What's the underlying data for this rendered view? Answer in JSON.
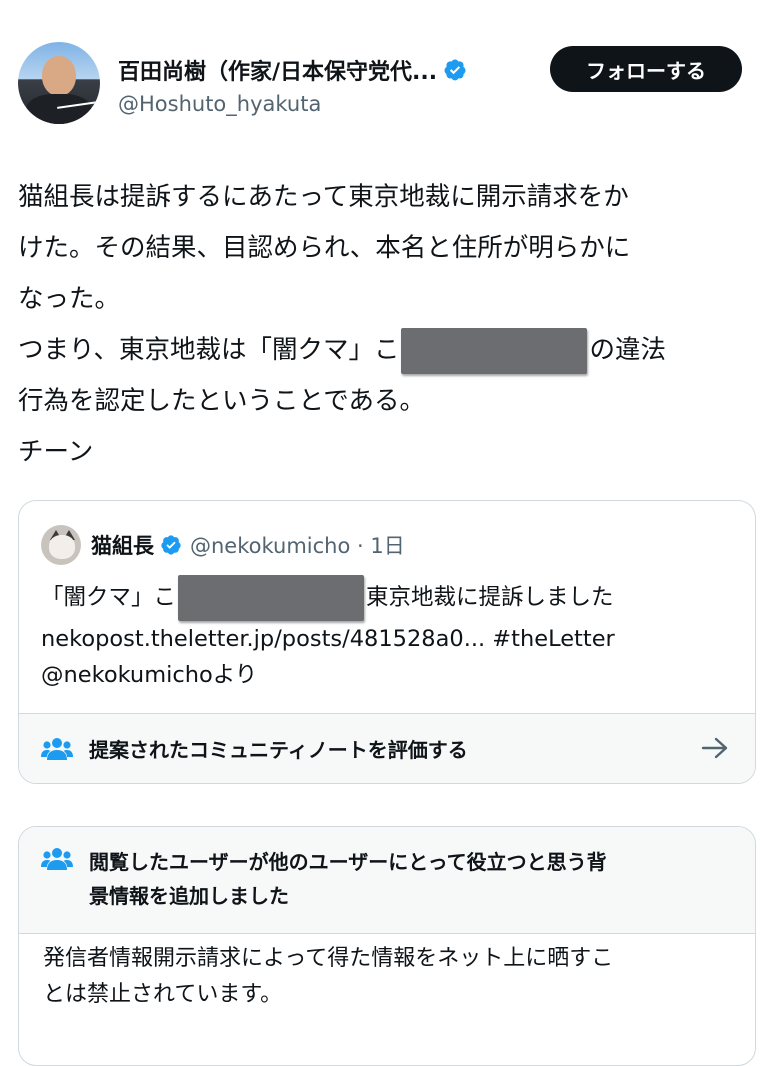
{
  "author": {
    "name": "百田尚樹（作家/日本保守党代...",
    "handle": "@Hoshuto_hyakuta",
    "follow_label": "フォローする"
  },
  "post": {
    "lines": [
      "猫組長は提訴するにあたって東京地裁に開示請求をか",
      "けた。その結果、目認められ、本名と住所が明らかに",
      "なった。",
      "つまり、東京地裁は「闇クマ」こ",
      "の違法",
      "行為を認定したということである。",
      "チーン"
    ]
  },
  "quote": {
    "name": "猫組長",
    "meta": "@nekokumicho · 1日",
    "line1_prefix": "「闇クマ」こ",
    "line1_suffix": "東京地裁に提訴しました",
    "line2": "nekopost.theletter.jp/posts/481528a0... #theLetter",
    "line3": "@nekokumichoより",
    "community_note_prompt": "提案されたコミュニティノートを評価する"
  },
  "community_note": {
    "title_lines": [
      "閲覧したユーザーが他のユーザーにとって役立つと思う背",
      "景情報を追加しました"
    ],
    "body_lines": [
      "発信者情報開示請求によって得た情報をネット上に晒すこ",
      "とは禁止されています。"
    ]
  },
  "colors": {
    "verified": "#1d9bf0",
    "text": "#0f1419",
    "secondary": "#536471",
    "border": "#cfd9de",
    "note_bg": "#f7f9f9",
    "redaction": "#6b6d70"
  },
  "icons": [
    "verified-badge-icon",
    "community-notes-icon",
    "arrow-right-icon"
  ]
}
